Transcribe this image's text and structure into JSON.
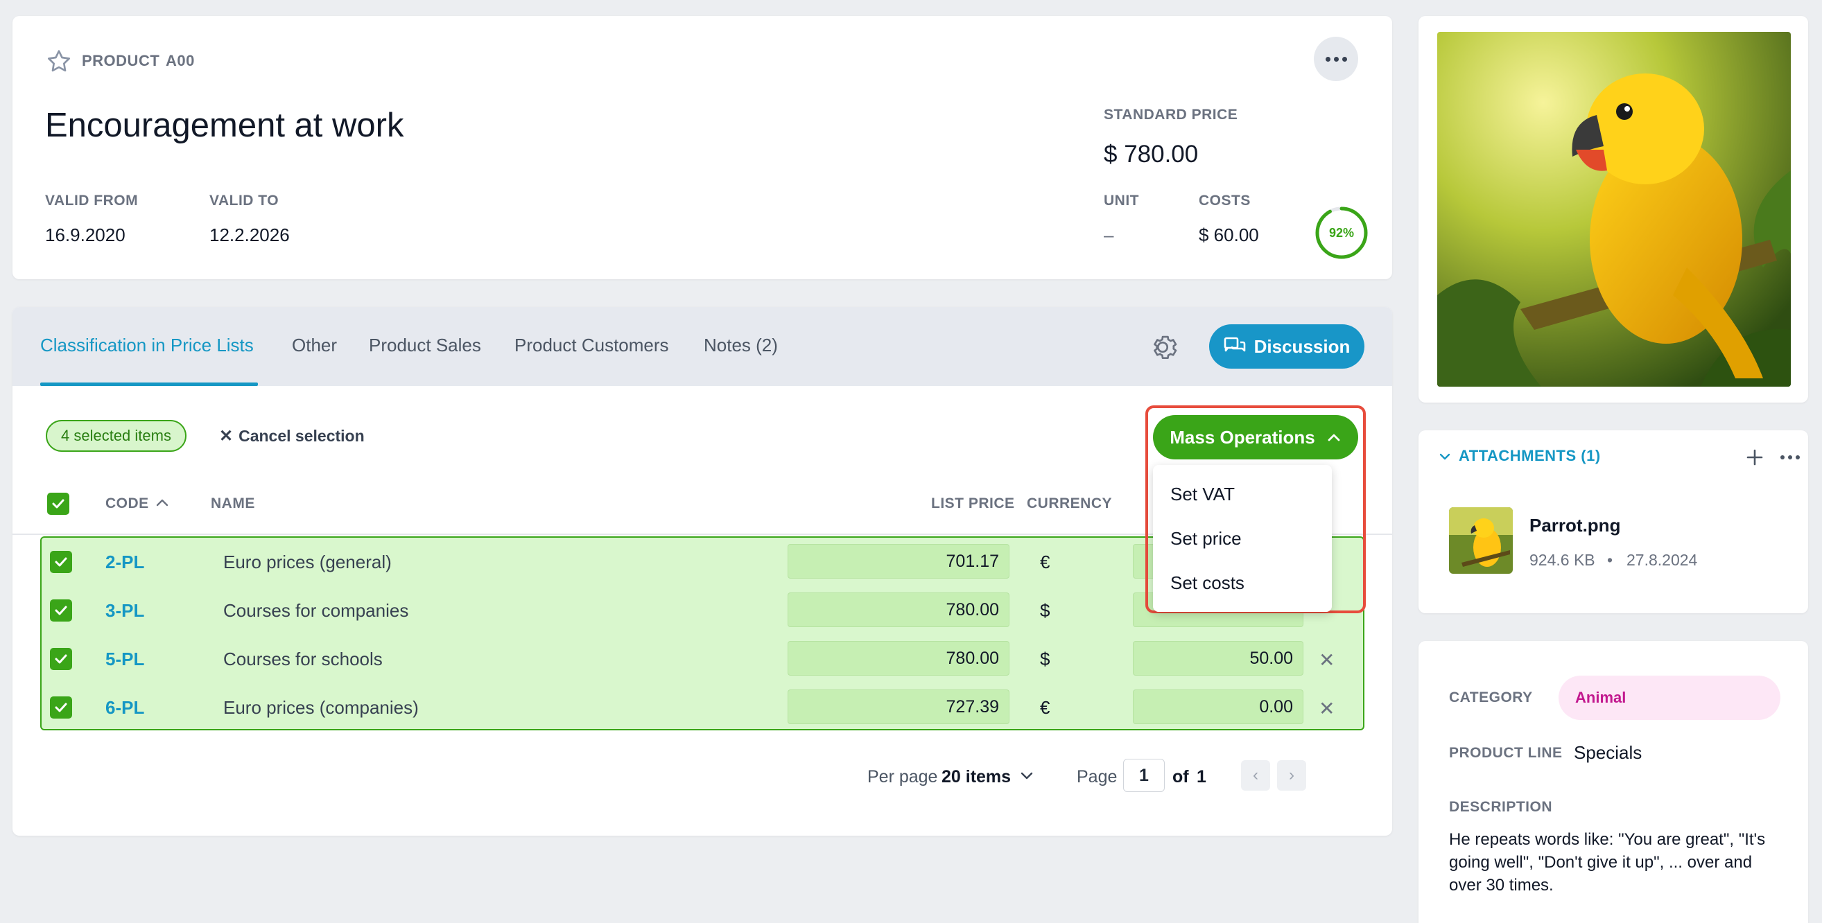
{
  "header": {
    "type_label": "PRODUCT",
    "code": "A00",
    "title": "Encouragement at work",
    "valid_from_label": "VALID FROM",
    "valid_from": "16.9.2020",
    "valid_to_label": "VALID TO",
    "valid_to": "12.2.2026",
    "standard_price_label": "STANDARD PRICE",
    "standard_price": "$ 780.00",
    "unit_label": "UNIT",
    "unit": "–",
    "costs_label": "COSTS",
    "costs": "$ 60.00",
    "completion_text": "92%",
    "completion": 0.92
  },
  "tabs": [
    {
      "label": "Classification in Price Lists",
      "active": true
    },
    {
      "label": "Other"
    },
    {
      "label": "Product Sales"
    },
    {
      "label": "Product Customers"
    },
    {
      "label": "Notes (2)"
    }
  ],
  "discussion_label": "Discussion",
  "selection": {
    "badge": "4 selected items",
    "cancel": "Cancel selection"
  },
  "mass_operations": {
    "label": "Mass Operations",
    "items": [
      "Set VAT",
      "Set price",
      "Set costs"
    ]
  },
  "table": {
    "headers": {
      "code": "CODE",
      "name": "NAME",
      "list_price": "LIST PRICE",
      "currency": "CURRENCY"
    },
    "rows": [
      {
        "code": "2-PL",
        "name": "Euro prices (general)",
        "list_price": "701.17",
        "currency": "€",
        "costs": ""
      },
      {
        "code": "3-PL",
        "name": "Courses for companies",
        "list_price": "780.00",
        "currency": "$",
        "costs": ""
      },
      {
        "code": "5-PL",
        "name": "Courses for schools",
        "list_price": "780.00",
        "currency": "$",
        "costs": "50.00"
      },
      {
        "code": "6-PL",
        "name": "Euro prices (companies)",
        "list_price": "727.39",
        "currency": "€",
        "costs": "0.00"
      }
    ]
  },
  "pager": {
    "per_page_label": "Per page",
    "per_page_value": "20 items",
    "page_label": "Page",
    "page": "1",
    "of_label": "of",
    "total": "1"
  },
  "attachments": {
    "title": "ATTACHMENTS (1)",
    "file_name": "Parrot.png",
    "file_size": "924.6 KB",
    "file_date": "27.8.2024"
  },
  "details": {
    "category_label": "CATEGORY",
    "category": "Animal",
    "product_line_label": "PRODUCT LINE",
    "product_line": "Specials",
    "description_label": "DESCRIPTION",
    "description": "He repeats words like: \"You are great\", \"It's going well\", \"Don't give it up\", ... over and over 30 times."
  },
  "colors": {
    "accent_blue": "#1896c8",
    "accent_green": "#3aa518",
    "highlight_red": "#e74c3c",
    "category_pink": "#c2188e"
  }
}
